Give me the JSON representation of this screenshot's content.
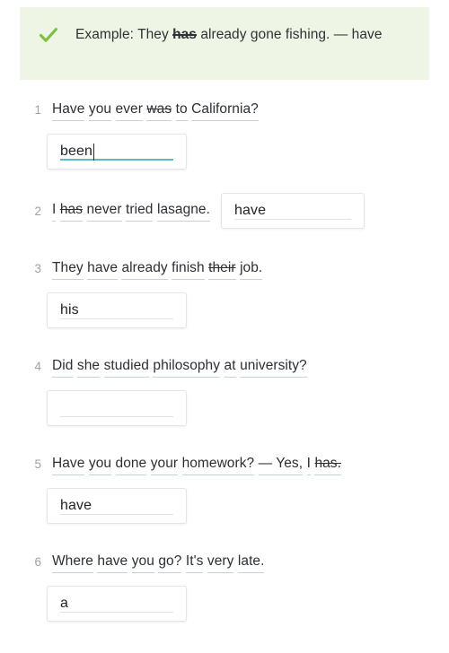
{
  "example": {
    "icon": "check-icon",
    "icon_color": "#7ac143",
    "background": "#eef5e4",
    "prefix": "Example: They ",
    "strike_word": "has",
    "suffix": " already gone fishing. — have",
    "full_text": "Example: They has already gone fishing. — have"
  },
  "colors": {
    "page_background": "#ffffff",
    "banner_background": "#eef5e4",
    "check_green": "#7ac143",
    "word_underline": "#c2d3e2",
    "number_gray": "#9aa2ab",
    "input_border": "#e3e6e9",
    "input_rule": "#e0e3e6",
    "input_rule_focused": "#57bcc9",
    "text": "#2b3035"
  },
  "questions": [
    {
      "number": "1",
      "layout": "stacked",
      "words": [
        {
          "text": "Have",
          "strike": false
        },
        {
          "text": "you",
          "strike": false
        },
        {
          "text": "ever",
          "strike": false
        },
        {
          "text": "was",
          "strike": true
        },
        {
          "text": "to",
          "strike": false
        },
        {
          "text": "California?",
          "strike": false
        }
      ],
      "sentence": "Have you ever was to California?",
      "answer": {
        "value": "been",
        "placeholder": "",
        "focused": true,
        "has_caret": true
      }
    },
    {
      "number": "2",
      "layout": "inline",
      "words": [
        {
          "text": "I",
          "strike": false
        },
        {
          "text": "has",
          "strike": true
        },
        {
          "text": "never",
          "strike": false
        },
        {
          "text": "tried",
          "strike": false
        },
        {
          "text": "lasagne.",
          "strike": false
        }
      ],
      "sentence": "I has never tried lasagne.",
      "answer": {
        "value": "have",
        "placeholder": "",
        "focused": false,
        "has_caret": false
      }
    },
    {
      "number": "3",
      "layout": "stacked",
      "words": [
        {
          "text": "They",
          "strike": false
        },
        {
          "text": "have",
          "strike": false
        },
        {
          "text": "already",
          "strike": false
        },
        {
          "text": "finish",
          "strike": false
        },
        {
          "text": "their",
          "strike": true
        },
        {
          "text": "job.",
          "strike": false
        }
      ],
      "sentence": "They have already finish their job.",
      "answer": {
        "value": "his",
        "placeholder": "",
        "focused": false,
        "has_caret": false
      }
    },
    {
      "number": "4",
      "layout": "stacked",
      "words": [
        {
          "text": "Did",
          "strike": false
        },
        {
          "text": "she",
          "strike": false
        },
        {
          "text": "studied",
          "strike": false
        },
        {
          "text": "philosophy",
          "strike": false
        },
        {
          "text": "at",
          "strike": false
        },
        {
          "text": "university?",
          "strike": false
        }
      ],
      "sentence": "Did she studied philosophy at university?",
      "answer": {
        "value": "",
        "placeholder": "",
        "focused": false,
        "has_caret": false
      }
    },
    {
      "number": "5",
      "layout": "stacked",
      "words": [
        {
          "text": "Have",
          "strike": false
        },
        {
          "text": "you",
          "strike": false
        },
        {
          "text": "done",
          "strike": false
        },
        {
          "text": "your",
          "strike": false
        },
        {
          "text": "homework?",
          "strike": false
        },
        {
          "text": "— Yes,",
          "strike": false
        },
        {
          "text": "I",
          "strike": false
        },
        {
          "text": "has.",
          "strike": true
        }
      ],
      "sentence": "Have you done your homework? — Yes, I has.",
      "answer": {
        "value": "have",
        "placeholder": "",
        "focused": false,
        "has_caret": false
      }
    },
    {
      "number": "6",
      "layout": "stacked",
      "words": [
        {
          "text": "Where",
          "strike": false
        },
        {
          "text": "have",
          "strike": false
        },
        {
          "text": "you",
          "strike": false
        },
        {
          "text": "go?",
          "strike": false
        },
        {
          "text": "It's",
          "strike": false
        },
        {
          "text": "very",
          "strike": false
        },
        {
          "text": "late.",
          "strike": false
        }
      ],
      "sentence": "Where have you go? It's very late.",
      "answer": {
        "value": "a",
        "placeholder": "",
        "focused": false,
        "has_caret": false
      }
    }
  ]
}
